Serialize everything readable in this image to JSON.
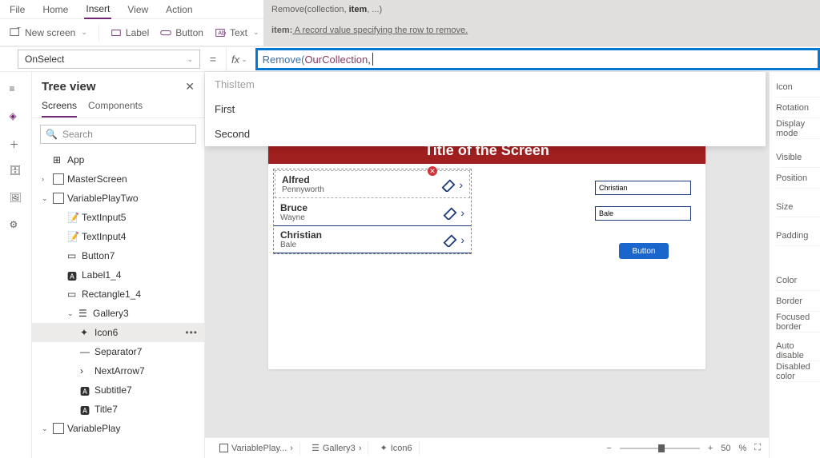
{
  "menubar": {
    "items": [
      "File",
      "Home",
      "Insert",
      "View",
      "Action"
    ],
    "active": 2
  },
  "ribbon": {
    "newscreen": "New screen",
    "label": "Label",
    "button": "Button",
    "text": "Text"
  },
  "hint": {
    "signature_fn": "Remove",
    "signature_args": "(collection, ",
    "signature_bold": "item",
    "signature_rest": ", ...)",
    "desc_key": "item:",
    "desc_text": " A record value specifying the row to remove."
  },
  "fx": {
    "property": "OnSelect",
    "fn": "Remove",
    "open": "(",
    "arg": "OurCollection",
    "comma": ","
  },
  "suggest": {
    "items": [
      "ThisItem",
      "First",
      "Second"
    ]
  },
  "tree": {
    "title": "Tree view",
    "tabs": {
      "screens": "Screens",
      "components": "Components"
    },
    "search": "Search",
    "app": "App",
    "masterscreen": "MasterScreen",
    "variableplaytwo": "VariablePlayTwo",
    "textinput5": "TextInput5",
    "textinput4": "TextInput4",
    "button7": "Button7",
    "label1_4": "Label1_4",
    "rectangle1_4": "Rectangle1_4",
    "gallery3": "Gallery3",
    "icon6": "Icon6",
    "separator7": "Separator7",
    "nextarrow7": "NextArrow7",
    "subtitle7": "Subtitle7",
    "title7": "Title7",
    "variableplay": "VariablePlay"
  },
  "screen": {
    "title": "Title of the Screen"
  },
  "gallery": [
    {
      "first": "Alfred",
      "last": "Pennyworth"
    },
    {
      "first": "Bruce",
      "last": "Wayne"
    },
    {
      "first": "Christian",
      "last": "Bale"
    }
  ],
  "form": {
    "v1": "Christian",
    "v2": "Bale",
    "button": "Button"
  },
  "crumbs": {
    "screen": "VariablePlay...",
    "gallery": "Gallery3",
    "icon": "Icon6"
  },
  "zoom": {
    "value": "50",
    "pct": "%"
  },
  "props": {
    "icon": "Icon",
    "rotation": "Rotation",
    "displaymode": "Display mode",
    "visible": "Visible",
    "position": "Position",
    "size": "Size",
    "padding": "Padding",
    "color": "Color",
    "border": "Border",
    "focusedborder": "Focused border",
    "autodisable": "Auto disable",
    "disabledcolor": "Disabled color"
  }
}
